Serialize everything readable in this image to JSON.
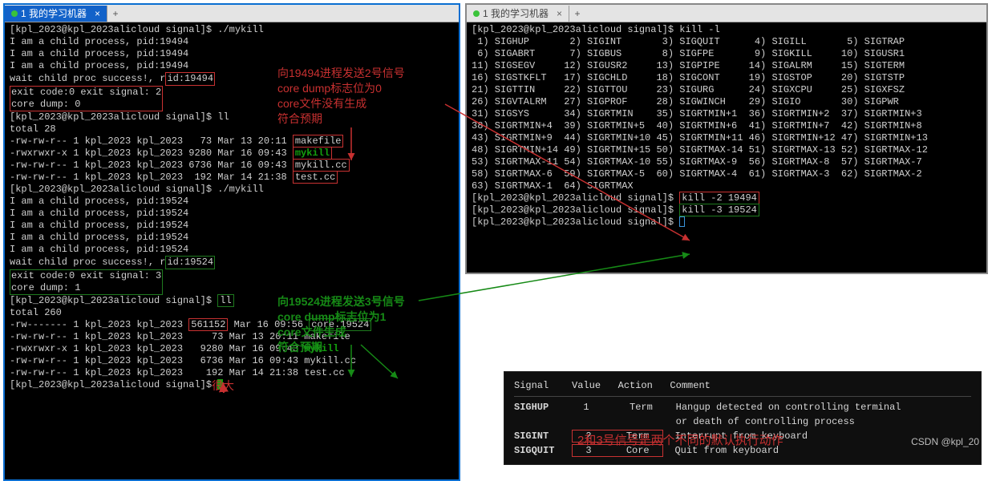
{
  "left": {
    "tab_title": "1 我的学习机器",
    "prompt": "[kpl_2023@kpl_2023alicloud signal]$",
    "cmd1": "./mykill",
    "child_lines1": [
      "I am a child process, pid:19494",
      "I am a child process, pid:19494",
      "I am a child process, pid:19494"
    ],
    "wait1_pre": "wait child proc success!, r",
    "wait1_box": "id:19494",
    "exit1": "exit code:0 exit signal: 2",
    "core1": "core dump: 0",
    "cmd_ll1": "ll",
    "total1": "total 28",
    "ls1": [
      "-rw-rw-r-- 1 kpl_2023 kpl_2023   73 Mar 13 20:11 ",
      "-rwxrwxr-x 1 kpl_2023 kpl_2023 9280 Mar 16 09:43 ",
      "-rw-rw-r-- 1 kpl_2023 kpl_2023 6736 Mar 16 09:43 ",
      "-rw-rw-r-- 1 kpl_2023 kpl_2023  192 Mar 14 21:38 "
    ],
    "ls1_f": [
      "makefile",
      "mykill",
      "mykill.cc",
      "test.cc"
    ],
    "child_lines2": [
      "I am a child process, pid:19524",
      "I am a child process, pid:19524",
      "I am a child process, pid:19524",
      "I am a child process, pid:19524",
      "I am a child process, pid:19524"
    ],
    "wait2_pre": "wait child proc success!, r",
    "wait2_box": "id:19524",
    "exit2": "exit code:0 exit signal: 3",
    "core2": "core dump: 1",
    "cmd_ll2": "ll",
    "total2": "total 260",
    "ls2_row0_a": "-rw------- 1 kpl_2023 kpl_2023 ",
    "ls2_row0_size": "561152",
    "ls2_row0_b": " Mar 16 09:56 ",
    "ls2_row0_file": "core.19524",
    "ls2": [
      "-rw-rw-r-- 1 kpl_2023 kpl_2023     73 Mar 13 20:11 makefile",
      "-rwxrwxr-x 1 kpl_2023 kpl_2023   9280 Mar 16 09:43 ",
      "-rw-rw-r-- 1 kpl_2023 kpl_2023   6736 Mar 16 09:43 mykill.cc",
      "-rw-rw-r-- 1 kpl_2023 kpl_2023    192 Mar 14 21:38 test.cc"
    ],
    "ls2_mykill": "mykill"
  },
  "right": {
    "tab_title": "1 我的学习机器",
    "cmd_kill_l": "kill -l",
    "signals": [
      [
        " 1) SIGHUP     ",
        " 2) SIGINT     ",
        " 3) SIGQUIT    ",
        " 4) SIGILL     ",
        " 5) SIGTRAP"
      ],
      [
        " 6) SIGABRT    ",
        " 7) SIGBUS     ",
        " 8) SIGFPE     ",
        " 9) SIGKILL    ",
        "10) SIGUSR1"
      ],
      [
        "11) SIGSEGV    ",
        "12) SIGUSR2    ",
        "13) SIGPIPE    ",
        "14) SIGALRM    ",
        "15) SIGTERM"
      ],
      [
        "16) SIGSTKFLT  ",
        "17) SIGCHLD    ",
        "18) SIGCONT    ",
        "19) SIGSTOP    ",
        "20) SIGTSTP"
      ],
      [
        "21) SIGTTIN    ",
        "22) SIGTTOU    ",
        "23) SIGURG     ",
        "24) SIGXCPU    ",
        "25) SIGXFSZ"
      ],
      [
        "26) SIGVTALRM  ",
        "27) SIGPROF    ",
        "28) SIGWINCH   ",
        "29) SIGIO      ",
        "30) SIGPWR"
      ],
      [
        "31) SIGSYS     ",
        "34) SIGRTMIN   ",
        "35) SIGRTMIN+1 ",
        "36) SIGRTMIN+2 ",
        "37) SIGRTMIN+3"
      ],
      [
        "38) SIGRTMIN+4 ",
        "39) SIGRTMIN+5 ",
        "40) SIGRTMIN+6 ",
        "41) SIGRTMIN+7 ",
        "42) SIGRTMIN+8"
      ],
      [
        "43) SIGRTMIN+9 ",
        "44) SIGRTMIN+10",
        "45) SIGRTMIN+11",
        "46) SIGRTMIN+12",
        "47) SIGRTMIN+13"
      ],
      [
        "48) SIGRTMIN+14",
        "49) SIGRTMIN+15",
        "50) SIGRTMAX-14",
        "51) SIGRTMAX-13",
        "52) SIGRTMAX-12"
      ],
      [
        "53) SIGRTMAX-11",
        "54) SIGRTMAX-10",
        "55) SIGRTMAX-9 ",
        "56) SIGRTMAX-8 ",
        "57) SIGRTMAX-7"
      ],
      [
        "58) SIGRTMAX-6 ",
        "59) SIGRTMAX-5 ",
        "60) SIGRTMAX-4 ",
        "61) SIGRTMAX-3 ",
        "62) SIGRTMAX-2"
      ],
      [
        "63) SIGRTMAX-1 ",
        "64) SIGRTMAX"
      ]
    ],
    "kill2": "kill -2 19494",
    "kill3": "kill -3 19524"
  },
  "annots": {
    "r1": "向19494进程发送2号信号",
    "r2": "core dump标志位为0",
    "r3": "core文件没有生成",
    "r4": "符合预期",
    "g1": "向19524进程发送3号信号",
    "g2": "core dump标志位为1",
    "g3": "core文件生成",
    "g4": "符合预期",
    "bigred": "很大",
    "bottom_red": "2和3号信号是两个不同的默认执行动作"
  },
  "sigtable": {
    "h1": "Signal",
    "h2": "Value",
    "h3": "Action",
    "h4": "Comment",
    "rows": [
      {
        "sig": "SIGHUP",
        "val": "1",
        "act": "Term",
        "cmt": "Hangup detected on controlling terminal\nor death of controlling process"
      },
      {
        "sig": "SIGINT",
        "val": "2",
        "act": "Term",
        "cmt": "Interrupt from keyboard"
      },
      {
        "sig": "SIGQUIT",
        "val": "3",
        "act": "Core",
        "cmt": "Quit from keyboard"
      }
    ]
  },
  "watermark": "CSDN @kpl_20"
}
